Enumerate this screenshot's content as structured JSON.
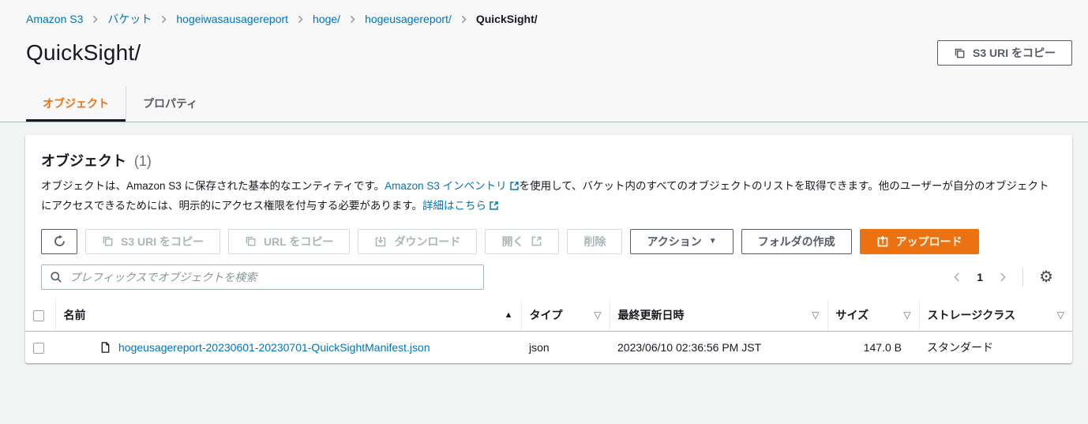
{
  "colors": {
    "accent_orange": "#ec7211",
    "link_blue": "#0073bb",
    "text_dark": "#16191f",
    "text_gray": "#545b64",
    "disabled_gray": "#aab7b8",
    "page_background": "#f2f3f3",
    "card_background": "#ffffff"
  },
  "breadcrumb": {
    "items": [
      "Amazon S3",
      "バケット",
      "hogeiwasausagereport",
      "hoge/",
      "hogeusagereport/",
      "QuickSight/"
    ]
  },
  "header": {
    "title": "QuickSight/",
    "copy_s3_uri_button": "S3 URI をコピー"
  },
  "tabs": {
    "objects": "オブジェクト",
    "properties": "プロパティ"
  },
  "panel": {
    "title": "オブジェクト",
    "count": "(1)",
    "description": {
      "text_1": "オブジェクトは、Amazon S3 に保存された基本的なエンティティです。",
      "link_1": "Amazon S3 インベントリ",
      "text_2": "を使用して、バケット内のすべてのオブジェクトのリストを取得できます。他のユーザーが自分のオブジェクトにアクセスできるためには、明示的にアクセス権限を付与する必要があります。",
      "link_2": "詳細はこちら"
    },
    "toolbar": {
      "copy_s3_uri": "S3 URI をコピー",
      "copy_url": "URL をコピー",
      "download": "ダウンロード",
      "open": "開く",
      "delete": "削除",
      "actions": "アクション",
      "create_folder": "フォルダの作成",
      "upload": "アップロード"
    },
    "search": {
      "placeholder": "プレフィックスでオブジェクトを検索"
    },
    "pagination": {
      "current_page": "1"
    },
    "table": {
      "columns": {
        "name": "名前",
        "type": "タイプ",
        "last_modified": "最終更新日時",
        "size": "サイズ",
        "storage_class": "ストレージクラス"
      },
      "rows": [
        {
          "name": "hogeusagereport-20230601-20230701-QuickSightManifest.json",
          "type": "json",
          "last_modified": "2023/06/10 02:36:56 PM JST",
          "size": "147.0 B",
          "storage_class": "スタンダード"
        }
      ]
    }
  },
  "icons": {
    "gear": "⚙",
    "caret_down": "▼",
    "sort_ascending": "▲",
    "sort_none": "▽"
  }
}
